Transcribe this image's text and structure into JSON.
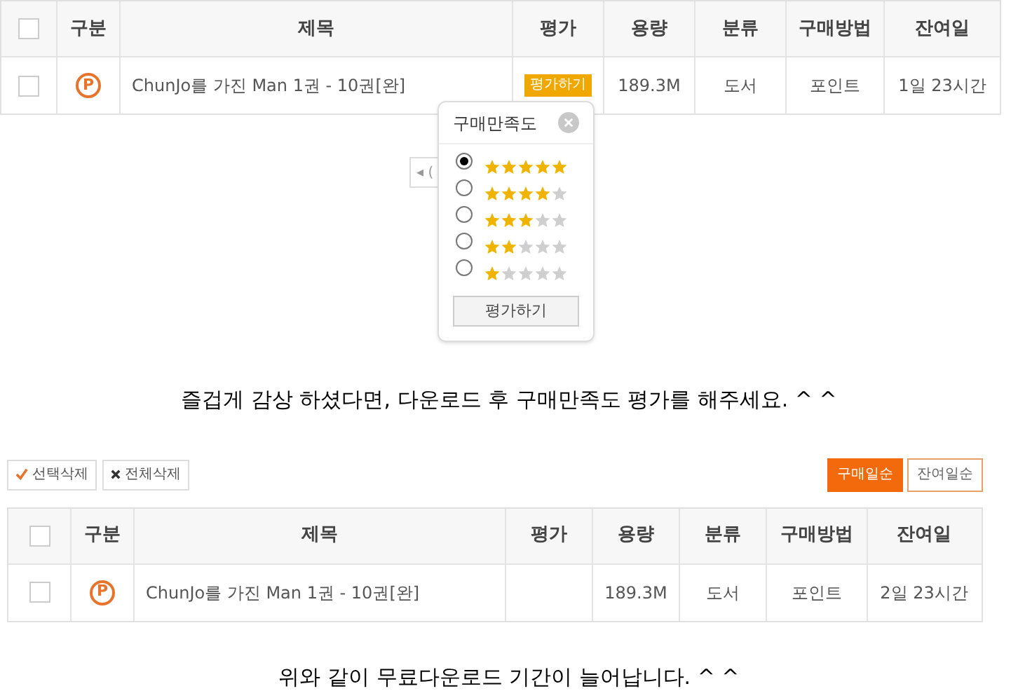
{
  "table_top": {
    "select_all_checked": false,
    "columns": [
      "구분",
      "제목",
      "평가",
      "용량",
      "분류",
      "구매방법",
      "잔여일"
    ],
    "rows": [
      {
        "checked": false,
        "type_mark": "P",
        "title": "ChunJo를 가진 Man 1권 - 10권[완]",
        "rate_button": "평가하기",
        "size": "189.3M",
        "category": "도서",
        "method": "포인트",
        "remaining": "1일 23시간"
      }
    ]
  },
  "pagination": {
    "label": "◂ ("
  },
  "rating_popup": {
    "title": "구매만족도",
    "options": [
      {
        "selected": true,
        "stars": 5
      },
      {
        "selected": false,
        "stars": 4
      },
      {
        "selected": false,
        "stars": 3
      },
      {
        "selected": false,
        "stars": 2
      },
      {
        "selected": false,
        "stars": 1
      }
    ],
    "submit": "평가하기"
  },
  "caption_1": "즐겁게 감상 하셨다면, 다운로드 후 구매만족도 평가를 해주세요. ^ ^",
  "toolbar": {
    "left": [
      {
        "label": "선택삭제",
        "kind": "check"
      },
      {
        "label": "전체삭제",
        "kind": "x"
      }
    ],
    "sort": [
      {
        "label": "구매일순",
        "selected": true
      },
      {
        "label": "잔여일순",
        "selected": false
      }
    ]
  },
  "table_bottom": {
    "select_all_checked": false,
    "columns": [
      "구분",
      "제목",
      "평가",
      "용량",
      "분류",
      "구매방법",
      "잔여일"
    ],
    "rows": [
      {
        "checked": false,
        "type_mark": "P",
        "title": "ChunJo를 가진 Man 1권 - 10권[완]",
        "size": "189.3M",
        "category": "도서",
        "method": "포인트",
        "remaining": "2일 23시간"
      }
    ]
  },
  "caption_2": "위와 같이 무료다운로드 기간이 늘어납니다. ^ ^"
}
